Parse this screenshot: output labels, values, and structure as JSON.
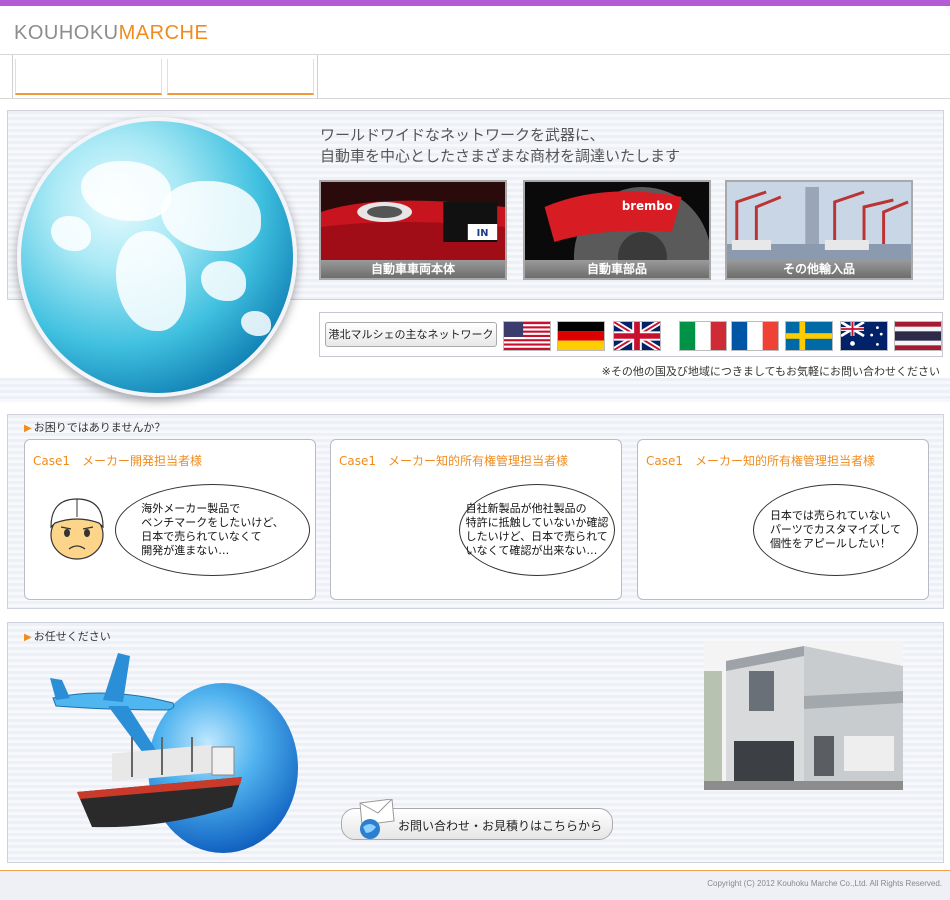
{
  "header": {
    "logo_part1": "KOUHOKU",
    "logo_part2": "MARCHE"
  },
  "hero": {
    "tagline_line1": "ワールドワイドなネットワークを武器に、",
    "tagline_line2": "自動車を中心としたさまざまな商材を調達いたします",
    "tiles": [
      {
        "label": "自動車車両本体"
      },
      {
        "label": "自動車部品"
      },
      {
        "label": "その他輸入品"
      }
    ],
    "brake_brand": "brembo",
    "plate_text": "IN"
  },
  "network": {
    "label": "港北マルシェの主なネットワーク",
    "flags": [
      "usa-flag",
      "germany-flag",
      "uk-flag",
      "italy-flag",
      "france-flag",
      "sweden-flag",
      "australia-flag",
      "thailand-flag"
    ],
    "note": "※その他の国及び地域につきましてもお気軽にお問い合わせください"
  },
  "trouble": {
    "heading": "お困りではありませんか？",
    "cards": [
      {
        "title": "Case1　メーカー開発担当者様",
        "bubble": [
          "海外メーカー製品で",
          "ベンチマークをしたいけど、",
          "日本で売られていなくて",
          "開発が進まない…"
        ]
      },
      {
        "title": "Case1　メーカー知的所有権管理担当者様",
        "bubble": [
          "自社新製品が他社製品の",
          "特許に抵触していないか確認",
          "したいけど、日本で売られて",
          "いなくて確認が出来ない…"
        ]
      },
      {
        "title": "Case1　メーカー知的所有権管理担当者様",
        "bubble": [
          "日本では売られていない",
          "パーツでカスタマイズして",
          "個性をアピールしたい！"
        ]
      }
    ]
  },
  "leave": {
    "heading": "お任せください",
    "contact_button": "お問い合わせ・お見積りはこちらから"
  },
  "footer": {
    "copyright": "Copyright (C) 2012 Kouhoku Marche Co.,Ltd. All Rights Reserved."
  },
  "colors": {
    "accent": "#f08c1e",
    "topbar": "#b45cd6",
    "logo_gray": "#8c8c8c"
  }
}
